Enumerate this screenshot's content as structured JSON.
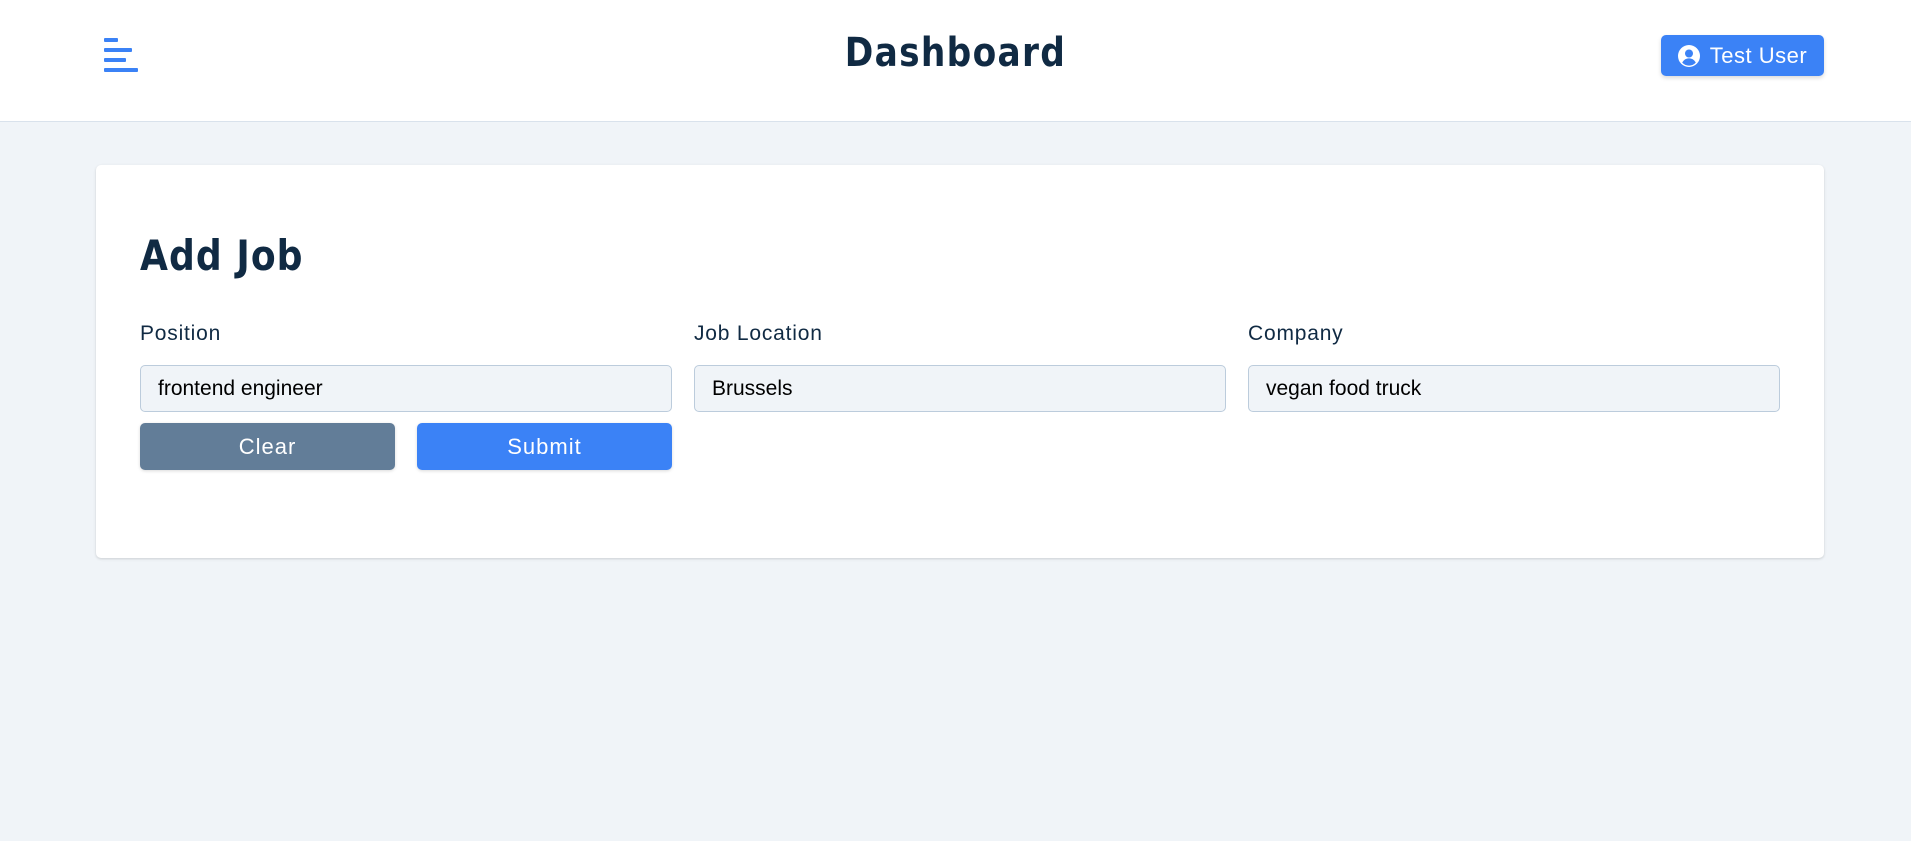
{
  "navbar": {
    "menu_icon": "menu-align-left-icon",
    "title": "Dashboard",
    "user_icon": "user-circle-icon",
    "user_name": "Test User"
  },
  "form": {
    "title": "Add Job",
    "fields": [
      {
        "label": "Position",
        "value": "frontend engineer"
      },
      {
        "label": "Job Location",
        "value": "Brussels"
      },
      {
        "label": "Company",
        "value": "vegan food truck"
      }
    ],
    "clear_label": "Clear",
    "submit_label": "Submit"
  },
  "colors": {
    "accent": "#3b82f6",
    "clear_button": "#627d98",
    "page_background": "#f0f4f8",
    "text_dark": "#102a43"
  }
}
